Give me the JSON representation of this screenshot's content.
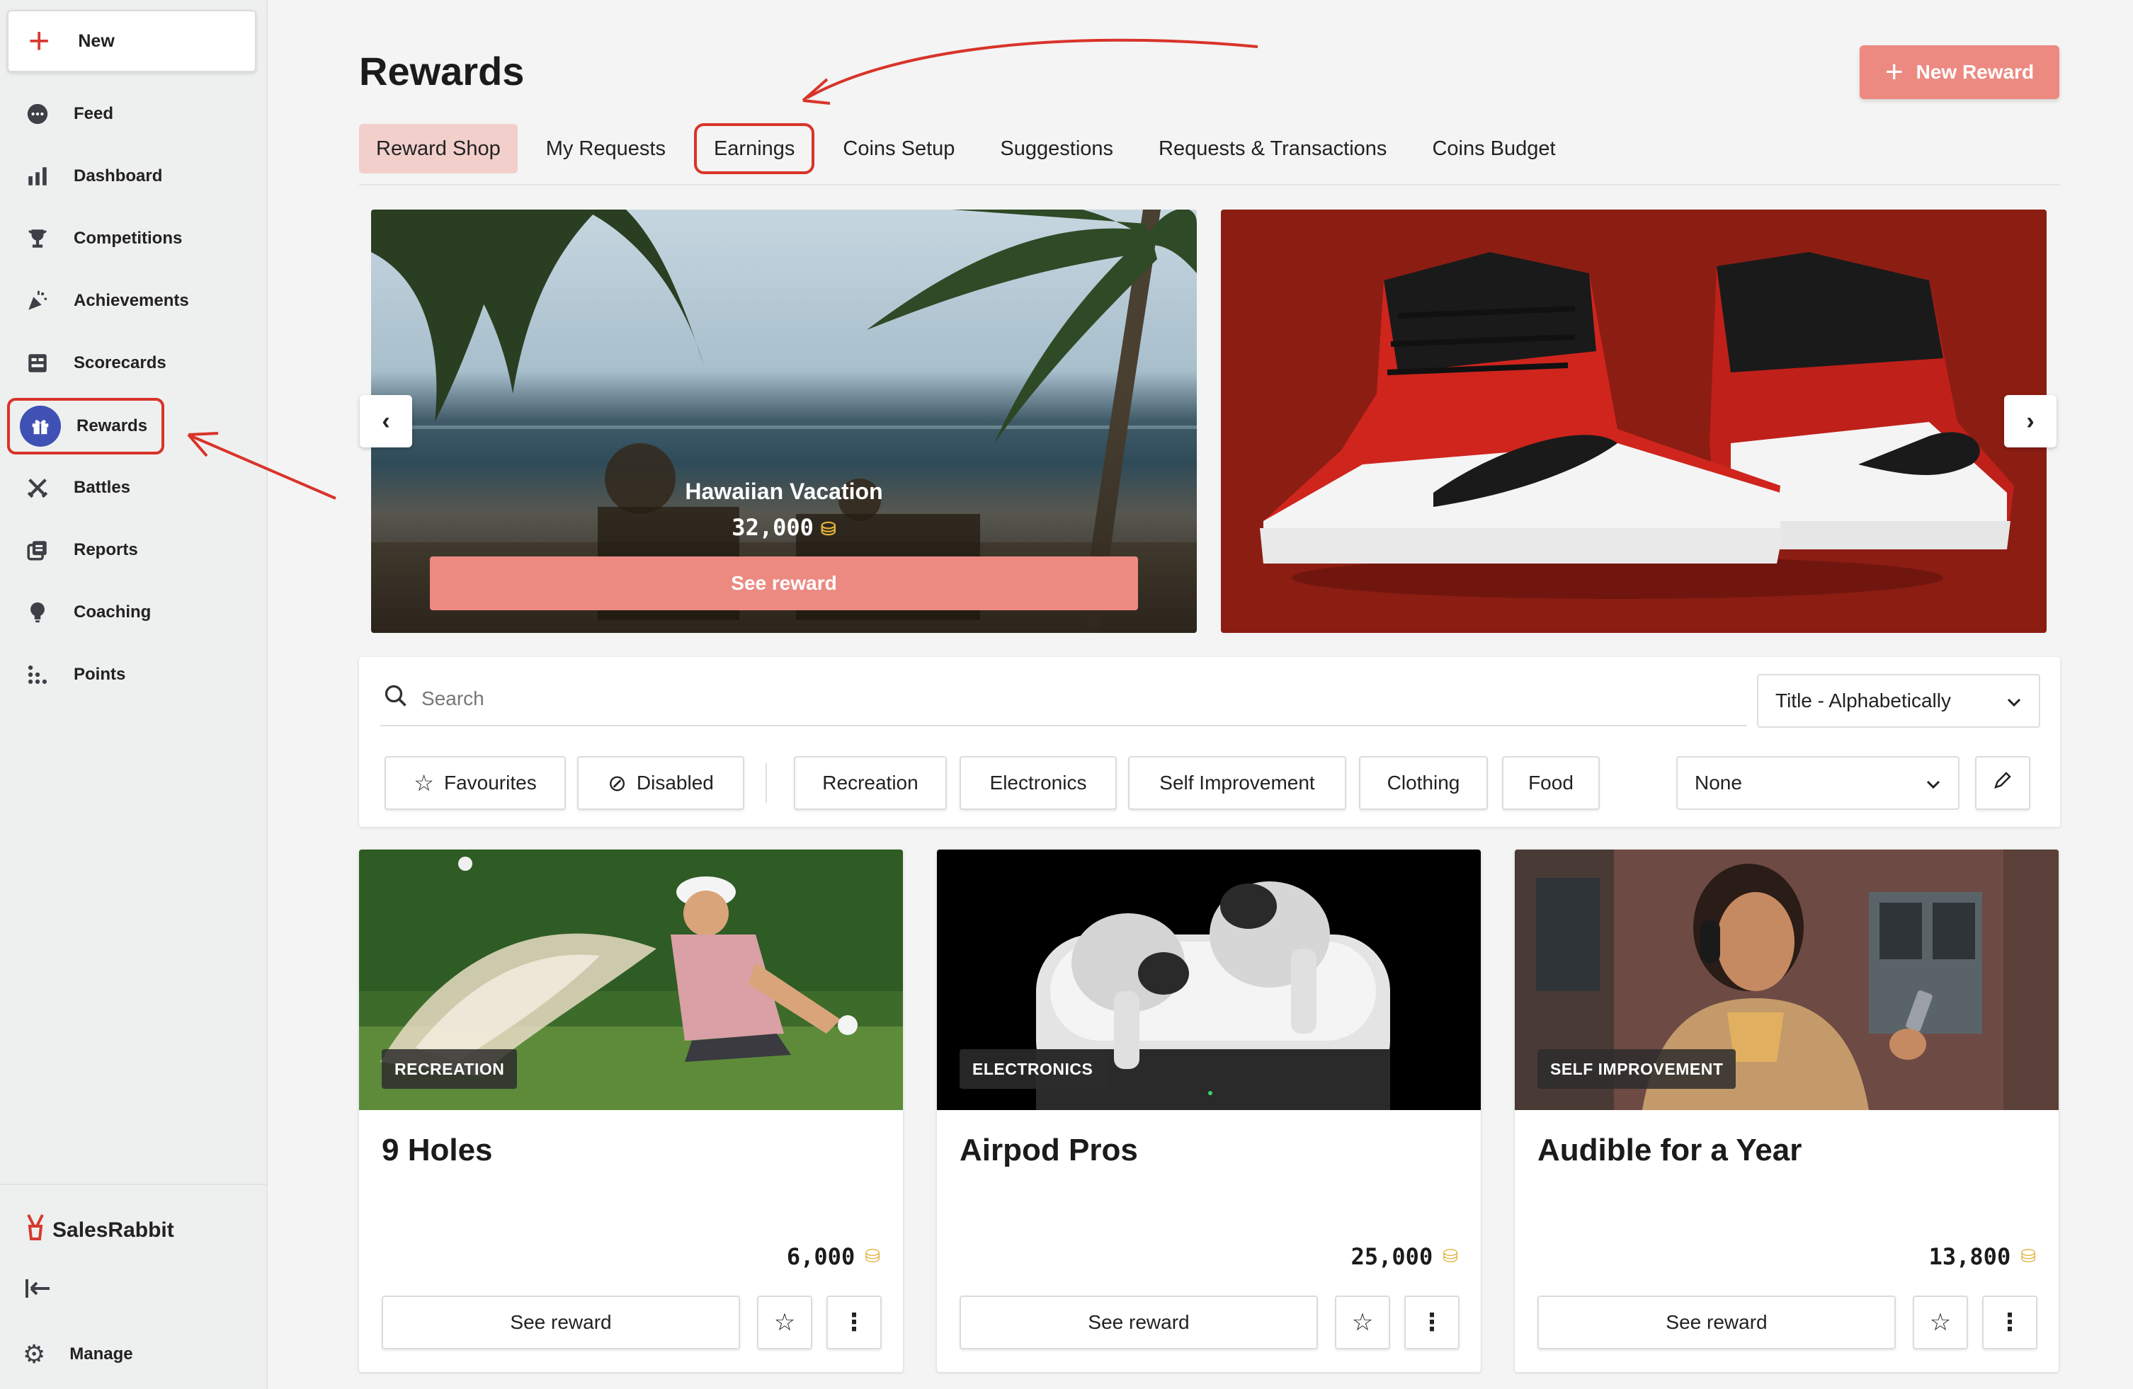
{
  "sidebar": {
    "new_label": "New",
    "items": [
      {
        "label": "Feed",
        "icon": "chat-icon"
      },
      {
        "label": "Dashboard",
        "icon": "bar-chart-icon"
      },
      {
        "label": "Competitions",
        "icon": "trophy-icon"
      },
      {
        "label": "Achievements",
        "icon": "confetti-icon"
      },
      {
        "label": "Scorecards",
        "icon": "scorecard-icon"
      },
      {
        "label": "Rewards",
        "icon": "gift-icon",
        "active": true
      },
      {
        "label": "Battles",
        "icon": "swords-icon"
      },
      {
        "label": "Reports",
        "icon": "reports-icon"
      },
      {
        "label": "Coaching",
        "icon": "lightbulb-icon"
      },
      {
        "label": "Points",
        "icon": "dots-icon"
      }
    ],
    "brand": "SalesRabbit",
    "manage_label": "Manage"
  },
  "header": {
    "title": "Rewards",
    "new_reward_label": "New Reward"
  },
  "tabs": [
    {
      "label": "Reward Shop",
      "active": true
    },
    {
      "label": "My Requests"
    },
    {
      "label": "Earnings",
      "circled": true
    },
    {
      "label": "Coins Setup"
    },
    {
      "label": "Suggestions"
    },
    {
      "label": "Requests & Transactions"
    },
    {
      "label": "Coins Budget"
    }
  ],
  "carousel": {
    "featured_title": "Hawaiian Vacation",
    "featured_coins": "32,000",
    "featured_button": "See reward"
  },
  "filters": {
    "search_placeholder": "Search",
    "sort_value": "Title - Alphabetically",
    "chips": [
      "Favourites",
      "Disabled",
      "Recreation",
      "Electronics",
      "Self Improvement",
      "Clothing",
      "Food"
    ],
    "group_value": "None"
  },
  "cards": [
    {
      "category": "RECREATION",
      "title": "9 Holes",
      "coins": "6,000",
      "button": "See reward"
    },
    {
      "category": "ELECTRONICS",
      "title": "Airpod Pros",
      "coins": "25,000",
      "button": "See reward"
    },
    {
      "category": "SELF IMPROVEMENT",
      "title": "Audible for a Year",
      "coins": "13,800",
      "button": "See reward"
    }
  ],
  "colors": {
    "accent": "#ec8a82",
    "active_tab": "#f2cfcb",
    "nav_active": "#3f51b5",
    "annotation": "#d9332a",
    "coin": "#e0b13a"
  }
}
